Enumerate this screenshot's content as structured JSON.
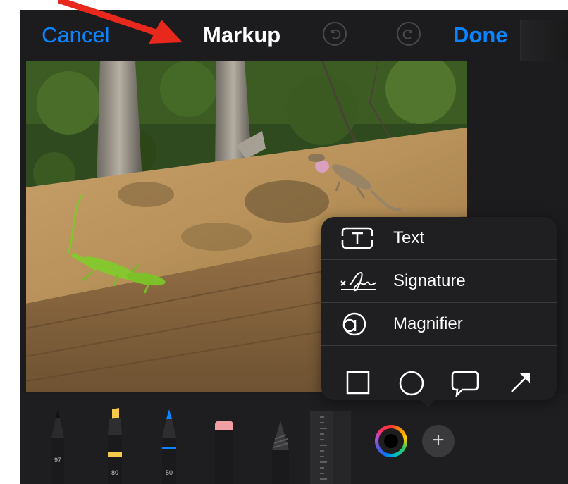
{
  "navbar": {
    "cancel_label": "Cancel",
    "title": "Markup",
    "done_label": "Done",
    "undo_icon": "undo-icon",
    "redo_icon": "redo-icon"
  },
  "tools": [
    {
      "name": "pen",
      "value": "97"
    },
    {
      "name": "highlighter",
      "value": "80",
      "tip_color": "#f7c948"
    },
    {
      "name": "pencil",
      "value": "50",
      "tip_color": "#0a84ff"
    },
    {
      "name": "eraser"
    },
    {
      "name": "lasso"
    },
    {
      "name": "ruler"
    }
  ],
  "color_well": {
    "selected_color": "#000000"
  },
  "add_button": {
    "label": "+"
  },
  "popup_menu": {
    "items": [
      {
        "label": "Text",
        "icon": "text-box-icon"
      },
      {
        "label": "Signature",
        "icon": "signature-icon"
      },
      {
        "label": "Magnifier",
        "icon": "magnifier-icon"
      }
    ],
    "shapes": [
      "square-icon",
      "circle-icon",
      "speech-bubble-icon",
      "arrow-icon"
    ]
  },
  "annotation": {
    "arrow_color": "#e8281c"
  },
  "colors": {
    "accent": "#0a84ff",
    "background": "#1c1c1e"
  }
}
